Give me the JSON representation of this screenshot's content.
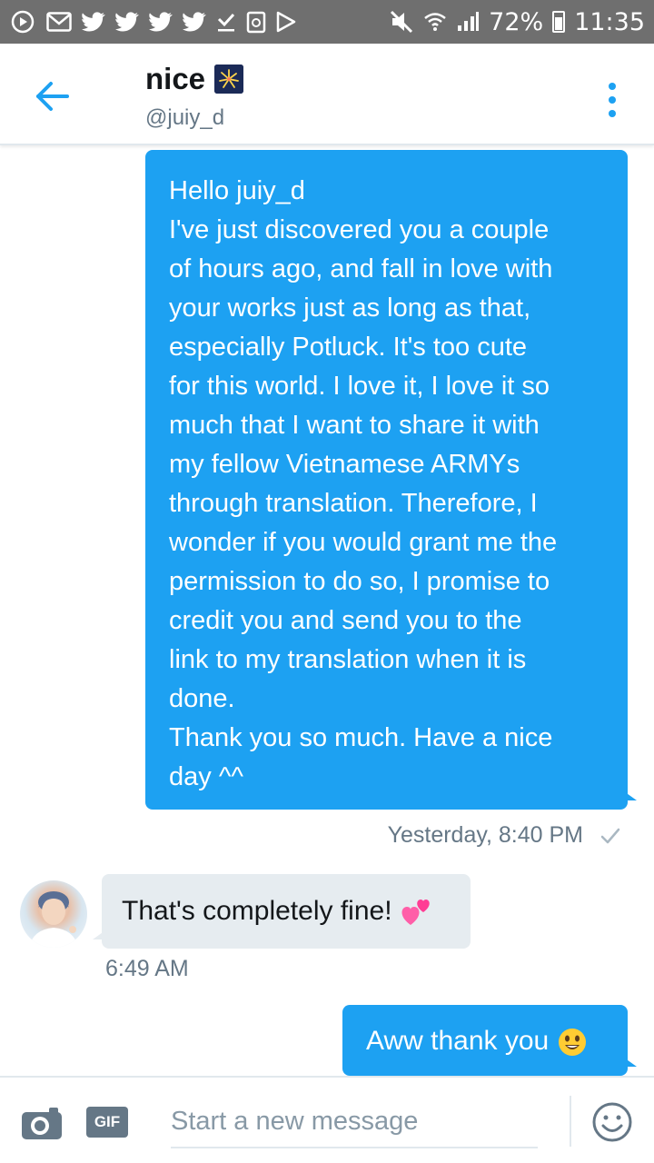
{
  "status_bar": {
    "battery": "72%",
    "time": "11:35"
  },
  "conversation": {
    "name": "nice",
    "handle": "@juiy_d",
    "title_emoji_icon": "fireworks-icon"
  },
  "messages": {
    "first": {
      "lines": [
        "Hello juiy_d",
        "I've just discovered you a couple",
        "of hours ago, and fall in love with",
        "your works just as long as that,",
        "especially Potluck. It's too cute",
        "for this world. I love it, I love it so",
        "much that I want to share it with",
        "my fellow Vietnamese ARMYs",
        "through translation. Therefore, I",
        "wonder if you would grant me the",
        "permission to do so, I promise to",
        "credit you and send you to the",
        "link to my translation when it is",
        "done.",
        "Thank you so much. Have a nice",
        "day ^^"
      ],
      "timestamp": "Yesterday, 8:40 PM"
    },
    "reply": {
      "text": "That's completely fine!",
      "timestamp": "6:49 AM"
    },
    "last": {
      "text": "Aww thank you"
    }
  },
  "composer": {
    "placeholder": "Start a new message",
    "gif_label": "GIF"
  },
  "colors": {
    "accent": "#1da1f2",
    "incoming_bubble": "#e6ecf0",
    "muted_text": "#657786",
    "status_bar": "#6f6f6f"
  }
}
